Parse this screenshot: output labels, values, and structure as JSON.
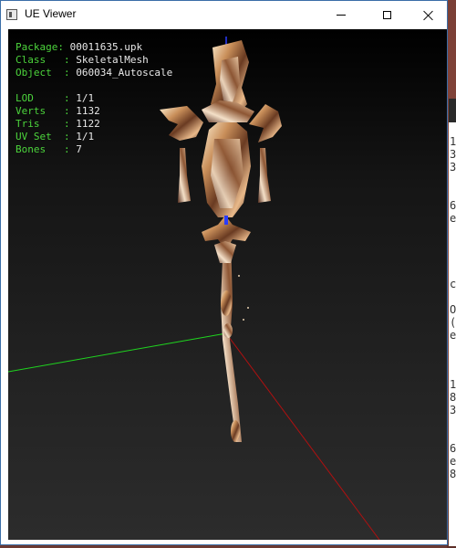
{
  "window": {
    "title": "UE Viewer",
    "controls": {
      "minimize": "minimize",
      "maximize": "maximize",
      "close": "close"
    }
  },
  "info": {
    "package": {
      "label": "Package",
      "value": "00011635.upk"
    },
    "class": {
      "label": "Class",
      "value": "SkeletalMesh"
    },
    "object": {
      "label": "Object",
      "value": "060034_Autoscale"
    },
    "lod": {
      "label": "LOD",
      "value": "1/1"
    },
    "verts": {
      "label": "Verts",
      "value": "1132"
    },
    "tris": {
      "label": "Tris",
      "value": "1122"
    },
    "uvset": {
      "label": "UV Set",
      "value": "1/1"
    },
    "bones": {
      "label": "Bones",
      "value": "7"
    }
  },
  "colors": {
    "label_green": "#4cd43c",
    "value_white": "#e8e8e8",
    "axis_green": "#1fd41f",
    "axis_red": "#b01010",
    "axis_blue": "#2a3cff"
  },
  "background_fragments": [
    "1",
    "3",
    "3",
    "6",
    "e",
    "c",
    "O",
    "(",
    "e",
    "1",
    "8",
    "3",
    "6",
    "e",
    "8"
  ]
}
